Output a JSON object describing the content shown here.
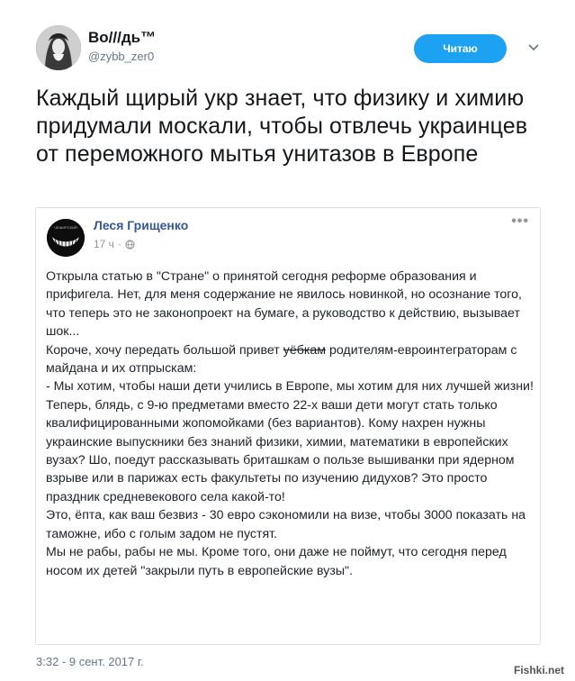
{
  "tweet": {
    "display_name": "Во///дь™",
    "handle": "@zybb_zer0",
    "follow_label": "Читаю",
    "text": "Каждый щирый укр знает, что физику и химию придумали москали, чтобы отвлечь украинцев от переможного мытья унитазов в Европе",
    "timestamp": "3:32 - 9 сент. 2017 г."
  },
  "embedded_post": {
    "author": "Леся Грищенко",
    "time": "17 ч",
    "more": "•••",
    "avatar_text": "ЧЕШИРСКИЙ",
    "body_lines": [
      "Открыла статью в \"Стране\" о принятой сегодня реформе образования и прифигела. Нет, для меня содержание не явилось новинкой, но осознание того, что теперь это не законопроект на бумаге, а руководство к действию, вызывает шок...",
      "Короче, хочу передать большой привет ",
      "уёбкам",
      " родителям-евроинтеграторам с майдана и их отпрыскам:",
      "- Мы хотим, чтобы наши дети учились в Европе, мы хотим для них лучшей жизни!",
      "Теперь, блядь, с 9-ю предметами вместо 22-х ваши дети могут стать только квалифицированными жопомойками (без вариантов). Кому нахрен нужны украинские выпускники без знаний физики, химии, математики в европейских вузах? Шо, поедут рассказывать бриташкам о пользе вышиванки при ядерном взрыве или в парижах есть факультеты по изучению дидухов? Это просто праздник средневекового села какой-то!",
      "Это, ёпта, как ваш безвиз - 30 евро сэкономили на визе, чтобы 3000 показать на таможне, ибо с голым задом не пустят.",
      "Мы не рабы, рабы не мы. Кроме того, они даже не поймут, что сегодня перед носом их детей \"закрыли путь в европейские вузы\"."
    ]
  },
  "watermark": "Fishki.net"
}
